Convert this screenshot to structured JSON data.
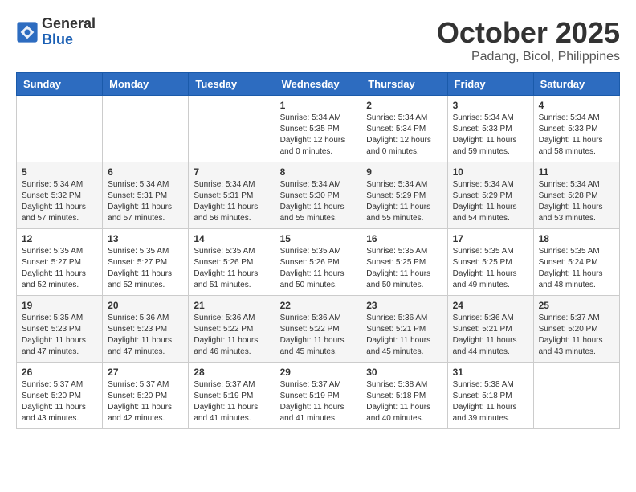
{
  "header": {
    "logo_line1": "General",
    "logo_line2": "Blue",
    "month": "October 2025",
    "location": "Padang, Bicol, Philippines"
  },
  "weekdays": [
    "Sunday",
    "Monday",
    "Tuesday",
    "Wednesday",
    "Thursday",
    "Friday",
    "Saturday"
  ],
  "weeks": [
    [
      {
        "day": "",
        "info": ""
      },
      {
        "day": "",
        "info": ""
      },
      {
        "day": "",
        "info": ""
      },
      {
        "day": "1",
        "info": "Sunrise: 5:34 AM\nSunset: 5:35 PM\nDaylight: 12 hours\nand 0 minutes."
      },
      {
        "day": "2",
        "info": "Sunrise: 5:34 AM\nSunset: 5:34 PM\nDaylight: 12 hours\nand 0 minutes."
      },
      {
        "day": "3",
        "info": "Sunrise: 5:34 AM\nSunset: 5:33 PM\nDaylight: 11 hours\nand 59 minutes."
      },
      {
        "day": "4",
        "info": "Sunrise: 5:34 AM\nSunset: 5:33 PM\nDaylight: 11 hours\nand 58 minutes."
      }
    ],
    [
      {
        "day": "5",
        "info": "Sunrise: 5:34 AM\nSunset: 5:32 PM\nDaylight: 11 hours\nand 57 minutes."
      },
      {
        "day": "6",
        "info": "Sunrise: 5:34 AM\nSunset: 5:31 PM\nDaylight: 11 hours\nand 57 minutes."
      },
      {
        "day": "7",
        "info": "Sunrise: 5:34 AM\nSunset: 5:31 PM\nDaylight: 11 hours\nand 56 minutes."
      },
      {
        "day": "8",
        "info": "Sunrise: 5:34 AM\nSunset: 5:30 PM\nDaylight: 11 hours\nand 55 minutes."
      },
      {
        "day": "9",
        "info": "Sunrise: 5:34 AM\nSunset: 5:29 PM\nDaylight: 11 hours\nand 55 minutes."
      },
      {
        "day": "10",
        "info": "Sunrise: 5:34 AM\nSunset: 5:29 PM\nDaylight: 11 hours\nand 54 minutes."
      },
      {
        "day": "11",
        "info": "Sunrise: 5:34 AM\nSunset: 5:28 PM\nDaylight: 11 hours\nand 53 minutes."
      }
    ],
    [
      {
        "day": "12",
        "info": "Sunrise: 5:35 AM\nSunset: 5:27 PM\nDaylight: 11 hours\nand 52 minutes."
      },
      {
        "day": "13",
        "info": "Sunrise: 5:35 AM\nSunset: 5:27 PM\nDaylight: 11 hours\nand 52 minutes."
      },
      {
        "day": "14",
        "info": "Sunrise: 5:35 AM\nSunset: 5:26 PM\nDaylight: 11 hours\nand 51 minutes."
      },
      {
        "day": "15",
        "info": "Sunrise: 5:35 AM\nSunset: 5:26 PM\nDaylight: 11 hours\nand 50 minutes."
      },
      {
        "day": "16",
        "info": "Sunrise: 5:35 AM\nSunset: 5:25 PM\nDaylight: 11 hours\nand 50 minutes."
      },
      {
        "day": "17",
        "info": "Sunrise: 5:35 AM\nSunset: 5:25 PM\nDaylight: 11 hours\nand 49 minutes."
      },
      {
        "day": "18",
        "info": "Sunrise: 5:35 AM\nSunset: 5:24 PM\nDaylight: 11 hours\nand 48 minutes."
      }
    ],
    [
      {
        "day": "19",
        "info": "Sunrise: 5:35 AM\nSunset: 5:23 PM\nDaylight: 11 hours\nand 47 minutes."
      },
      {
        "day": "20",
        "info": "Sunrise: 5:36 AM\nSunset: 5:23 PM\nDaylight: 11 hours\nand 47 minutes."
      },
      {
        "day": "21",
        "info": "Sunrise: 5:36 AM\nSunset: 5:22 PM\nDaylight: 11 hours\nand 46 minutes."
      },
      {
        "day": "22",
        "info": "Sunrise: 5:36 AM\nSunset: 5:22 PM\nDaylight: 11 hours\nand 45 minutes."
      },
      {
        "day": "23",
        "info": "Sunrise: 5:36 AM\nSunset: 5:21 PM\nDaylight: 11 hours\nand 45 minutes."
      },
      {
        "day": "24",
        "info": "Sunrise: 5:36 AM\nSunset: 5:21 PM\nDaylight: 11 hours\nand 44 minutes."
      },
      {
        "day": "25",
        "info": "Sunrise: 5:37 AM\nSunset: 5:20 PM\nDaylight: 11 hours\nand 43 minutes."
      }
    ],
    [
      {
        "day": "26",
        "info": "Sunrise: 5:37 AM\nSunset: 5:20 PM\nDaylight: 11 hours\nand 43 minutes."
      },
      {
        "day": "27",
        "info": "Sunrise: 5:37 AM\nSunset: 5:20 PM\nDaylight: 11 hours\nand 42 minutes."
      },
      {
        "day": "28",
        "info": "Sunrise: 5:37 AM\nSunset: 5:19 PM\nDaylight: 11 hours\nand 41 minutes."
      },
      {
        "day": "29",
        "info": "Sunrise: 5:37 AM\nSunset: 5:19 PM\nDaylight: 11 hours\nand 41 minutes."
      },
      {
        "day": "30",
        "info": "Sunrise: 5:38 AM\nSunset: 5:18 PM\nDaylight: 11 hours\nand 40 minutes."
      },
      {
        "day": "31",
        "info": "Sunrise: 5:38 AM\nSunset: 5:18 PM\nDaylight: 11 hours\nand 39 minutes."
      },
      {
        "day": "",
        "info": ""
      }
    ]
  ]
}
